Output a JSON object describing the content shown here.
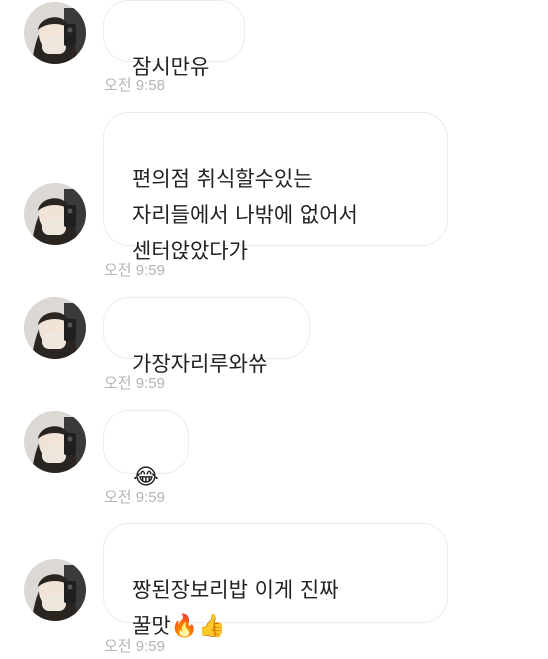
{
  "messages": [
    {
      "text": "잠시만유",
      "time": "오전 9:58"
    },
    {
      "text": "편의점 취식할수있는\n자리들에서 나밖에 없어서\n센터앉았다가",
      "time": "오전 9:59"
    },
    {
      "text": "가장자리루와쓔",
      "time": "오전 9:59"
    },
    {
      "emoji": "😂",
      "emoji_name": "face-with-tears-of-joy",
      "time": "오전 9:59"
    },
    {
      "text": "짱된장보리밥 이게 진짜\n꿀맛",
      "emoji": "🔥👍",
      "emoji_names": [
        "fire",
        "thumbs-up"
      ],
      "time": "오전 9:59"
    }
  ],
  "colors": {
    "bubble_border": "#ececec",
    "text": "#222222",
    "timestamp": "#b4b4b4",
    "background": "#ffffff"
  }
}
